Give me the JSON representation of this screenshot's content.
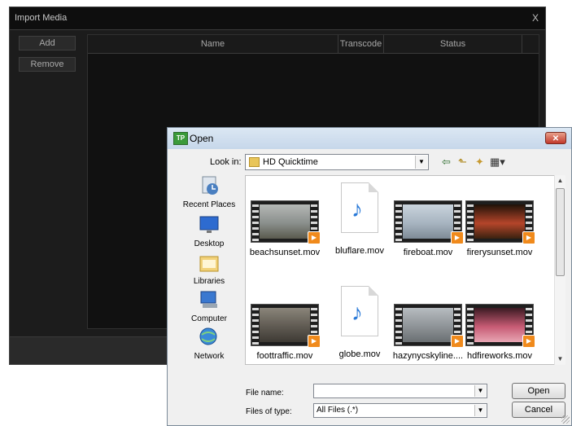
{
  "import_media": {
    "title": "Import Media",
    "close": "X",
    "add_label": "Add",
    "remove_label": "Remove",
    "columns": [
      "Name",
      "Transcode",
      "Status"
    ]
  },
  "open_dialog": {
    "title": "Open",
    "close": "✕",
    "look_in_label": "Look in:",
    "look_in_value": "HD Quicktime",
    "places": [
      "Recent Places",
      "Desktop",
      "Libraries",
      "Computer",
      "Network"
    ],
    "files": [
      {
        "name": "beachsunset.mov",
        "kind": "video",
        "colors": [
          "#b5b8b6",
          "#8a8f8c",
          "#5a5a4e"
        ]
      },
      {
        "name": "bluflare.mov",
        "kind": "audio"
      },
      {
        "name": "fireboat.mov",
        "kind": "video",
        "colors": [
          "#c9d3dc",
          "#a7b4c0",
          "#7e8b96"
        ]
      },
      {
        "name": "firerysunset.mov",
        "kind": "video",
        "colors": [
          "#1f1208",
          "#b5452a",
          "#3a2210"
        ]
      },
      {
        "name": "foottraffic.mov",
        "kind": "video",
        "colors": [
          "#8a857a",
          "#5f5a52",
          "#3e3a34"
        ]
      },
      {
        "name": "globe.mov",
        "kind": "audio"
      },
      {
        "name": "hazynycskyline....",
        "kind": "video",
        "colors": [
          "#b7bcc0",
          "#8e9397",
          "#6a6f72"
        ]
      },
      {
        "name": "hdfireworks.mov",
        "kind": "video",
        "colors": [
          "#3a1a22",
          "#c75b74",
          "#e8a6b4"
        ]
      }
    ],
    "file_name_label": "File name:",
    "file_name_value": "",
    "files_of_type_label": "Files of type:",
    "files_of_type_value": "All Files (.*)",
    "open_label": "Open",
    "cancel_label": "Cancel"
  }
}
